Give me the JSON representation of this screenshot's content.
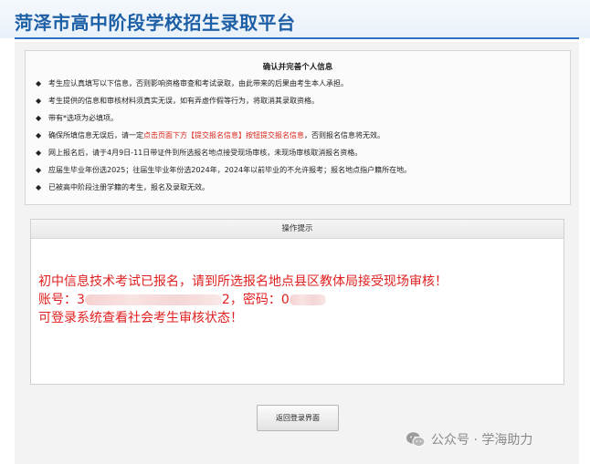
{
  "header": {
    "title": "菏泽市高中阶段学校招生录取平台"
  },
  "notice": {
    "title": "确认并完善个人信息",
    "items": [
      {
        "text": "考生应认真填写以下信息，否则影响资格审查和考试录取，由此带来的后果由考生本人承担。"
      },
      {
        "text": "考生提供的信息和审核材料须真实无误，如有弄虚作假等行为，将取消其录取资格。"
      },
      {
        "text": "带有*选项为必填项。"
      },
      {
        "before": "确保所填信息无误后，请一定",
        "highlight": "点击页面下方【提交报名信息】按钮提交报名信息",
        "after": "，否则报名信息将无效。"
      },
      {
        "text": "网上报名后，请于4月9日-11日带证件到所选报名地点接受现场审核，未现场审核取消报名资格。"
      },
      {
        "text": "应届生毕业年份选2025；往届生毕业年份选2024年，2024年以前毕业的不允许报考；报名地点指户籍所在地。"
      },
      {
        "text": "已被高中阶段注册学籍的考生，报名及录取无效。"
      }
    ]
  },
  "tip": {
    "heading": "操作提示",
    "line1": "初中信息技术考试已报名，请到所选报名地点县区教体局接受现场审核！",
    "account_label": "账号：",
    "account_start": "3",
    "account_end": "2",
    "password_label": "，密码：",
    "password_start": "0",
    "line3": "可登录系统查看社会考生审核状态！"
  },
  "buttons": {
    "back": "返回登录界面"
  },
  "watermark": {
    "text": "公众号 · 学海助力"
  },
  "colors": {
    "brand": "#1d5fa6",
    "alert": "#e02020",
    "highlight": "#d9261c"
  }
}
